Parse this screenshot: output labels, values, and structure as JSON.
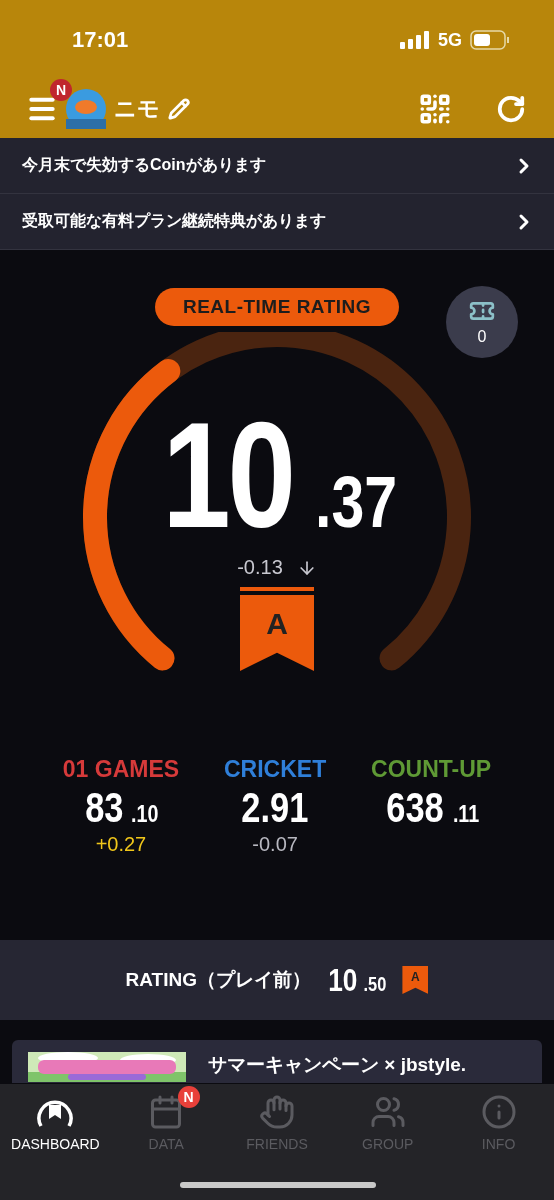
{
  "status_bar": {
    "time": "17:01",
    "network": "5G"
  },
  "header": {
    "menu_badge": "N",
    "user_name": "ニモ"
  },
  "notices": [
    {
      "text": "今月末で失効するCoinがあります"
    },
    {
      "text": "受取可能な有料プラン継続特典があります"
    }
  ],
  "realtime": {
    "label": "REAL-TIME RATING",
    "tickets": "0",
    "integer": "10",
    "decimal": ".37",
    "change": "-0.13",
    "grade": "A"
  },
  "stats": [
    {
      "name": "01 GAMES",
      "color": "#d63a3a",
      "integer": "83",
      "decimal": ".10",
      "change": {
        "text": "+0.27",
        "color": "#f0c61a"
      }
    },
    {
      "name": "CRICKET",
      "color": "#2f7fd9",
      "integer": "2.91",
      "change": {
        "text": "-0.07",
        "color": "#b8b8c0"
      }
    },
    {
      "name": "COUNT-UP",
      "color": "#5f9a35",
      "integer": "638",
      "decimal": ".11"
    }
  ],
  "before_play": {
    "label": "RATING（プレイ前）",
    "integer": "10",
    "decimal": ".50",
    "grade": "A"
  },
  "banner": {
    "title": "サマーキャンペーン × jbstyle."
  },
  "tabs": [
    {
      "label": "DASHBOARD",
      "selected": true
    },
    {
      "label": "DATA",
      "selected": false,
      "badge": "N"
    },
    {
      "label": "FRIENDS",
      "selected": false
    },
    {
      "label": "GROUP",
      "selected": false
    },
    {
      "label": "INFO",
      "selected": false
    }
  ]
}
